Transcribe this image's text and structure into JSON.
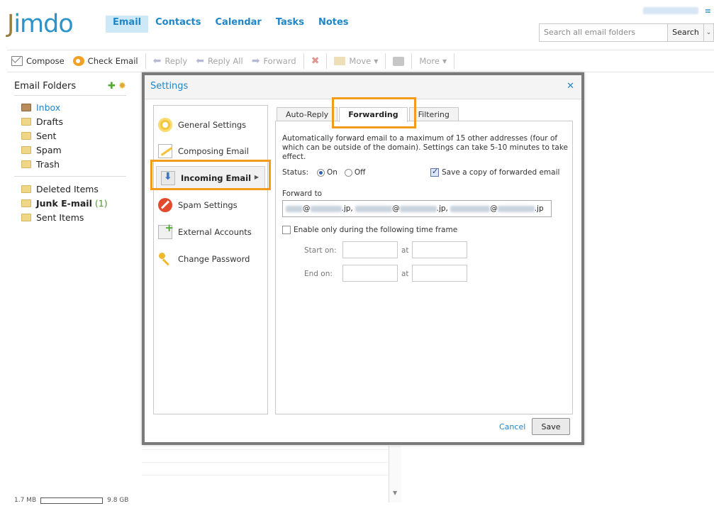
{
  "app": {
    "logo_first": "J",
    "logo_rest": "imdo"
  },
  "topnav": {
    "items": [
      "Email",
      "Contacts",
      "Calendar",
      "Tasks",
      "Notes"
    ],
    "active": "Email"
  },
  "search": {
    "placeholder": "Search all email folders",
    "button": "Search"
  },
  "toolbar": {
    "compose": "Compose",
    "check_email": "Check Email",
    "reply": "Reply",
    "reply_all": "Reply All",
    "forward": "Forward",
    "move": "Move",
    "more": "More"
  },
  "sidebar": {
    "title": "Email Folders",
    "folders": [
      "Inbox",
      "Drafts",
      "Sent",
      "Spam",
      "Trash"
    ],
    "other_folders": [
      "Deleted Items",
      "Junk E-mail",
      "Sent Items"
    ],
    "junk_count": "(1)",
    "quota_used": "1.7 MB",
    "quota_total": "9.8 GB"
  },
  "modal": {
    "title": "Settings",
    "nav": [
      "General Settings",
      "Composing Email",
      "Incoming Email",
      "Spam Settings",
      "External Accounts",
      "Change Password"
    ],
    "tabs": [
      "Auto-Reply",
      "Forwarding",
      "Filtering"
    ],
    "description": "Automatically forward email to a maximum of 15 other addresses (four of which can be outside of the domain). Settings can take 5-10 minutes to take effect.",
    "status_label": "Status:",
    "status_on": "On",
    "status_off": "Off",
    "save_copy": "Save a copy of forwarded email",
    "forward_to_label": "Forward to",
    "at_sign": "@",
    "domain_suffix": ".jp,",
    "domain_suffix_last": ".jp",
    "enable_label": "Enable only during the following time frame",
    "start_on": "Start on:",
    "end_on": "End on:",
    "at": "at",
    "cancel": "Cancel",
    "save": "Save"
  },
  "colors": {
    "accent": "#1f86c7",
    "highlight": "#f39b1b",
    "count_green": "#4d9a27"
  }
}
